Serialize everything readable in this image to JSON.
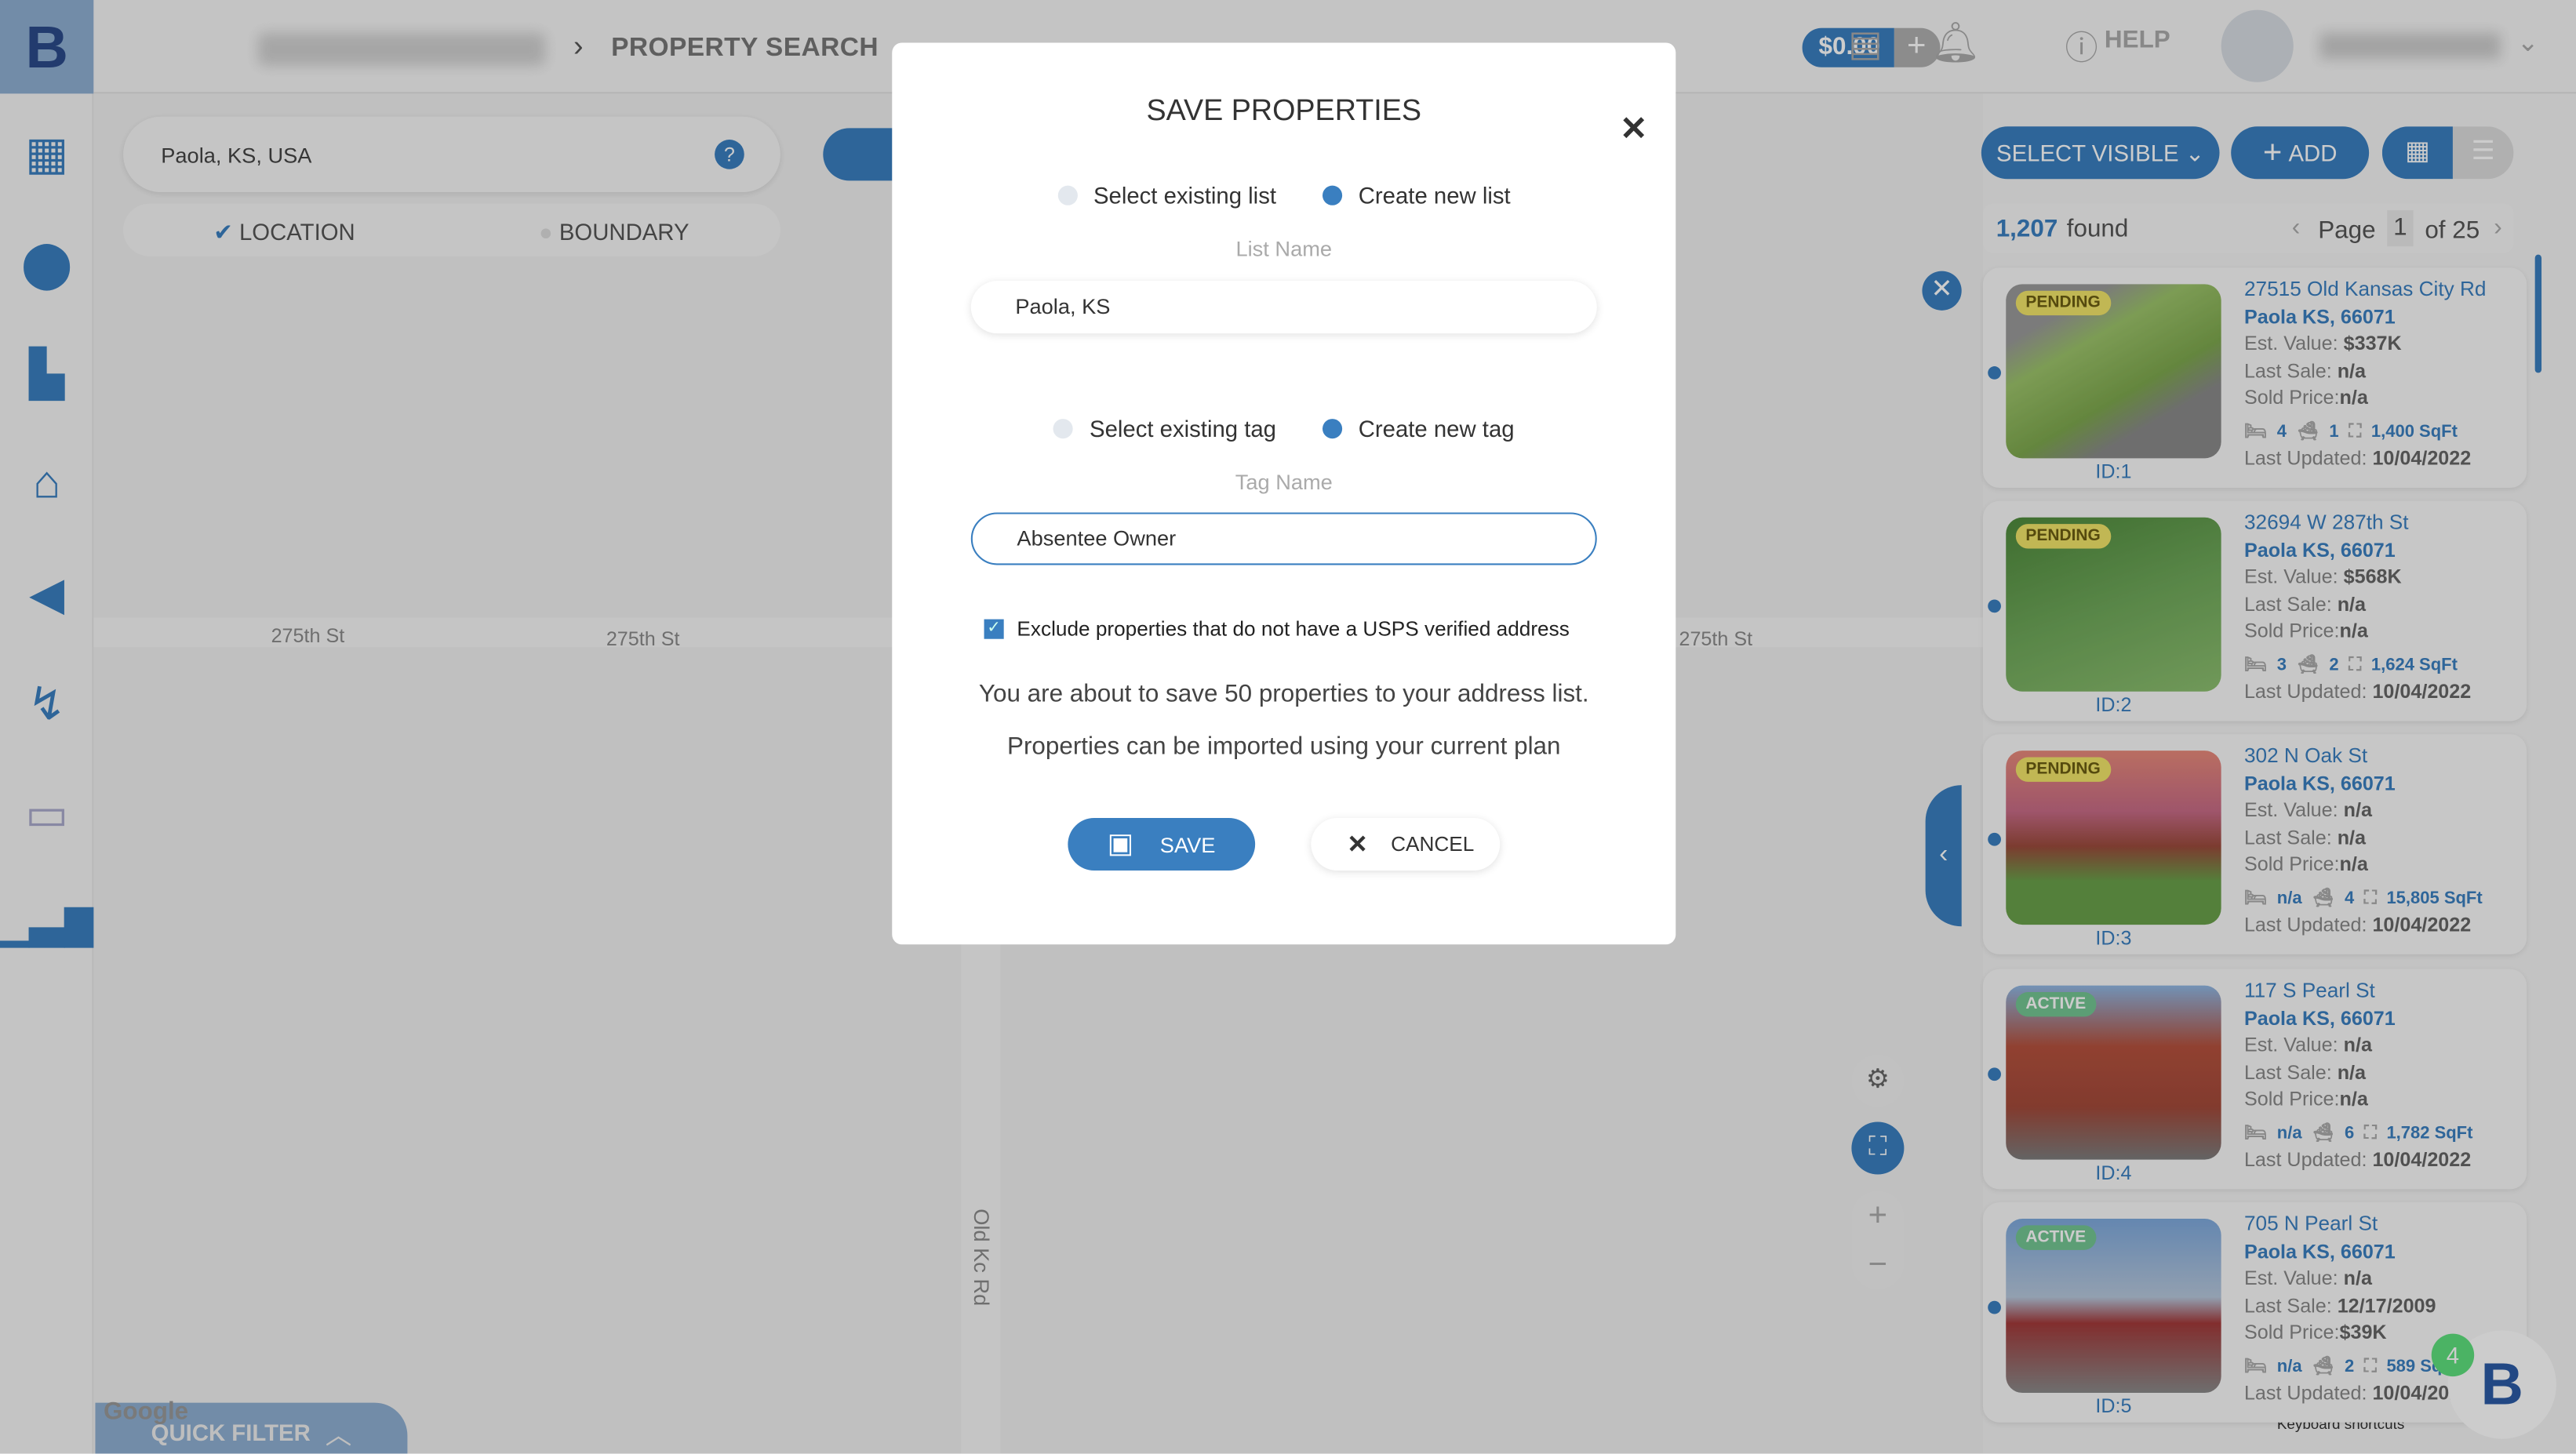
{
  "header": {
    "breadcrumb_current": "PROPERTY SEARCH",
    "credit": "$0.00",
    "help": "HELP"
  },
  "search": {
    "value": "Paola, KS, USA",
    "mode_location": "LOCATION",
    "mode_boundary": "BOUNDARY"
  },
  "map": {
    "streets": [
      "275th St",
      "275th St",
      "275th St"
    ],
    "road_vertical": "Old Kc Rd",
    "quick_filter": "QUICK FILTER",
    "google": "Google",
    "footer_shortcuts": "Keyboard shortcuts"
  },
  "results": {
    "select_visible": "SELECT VISIBLE",
    "add": "ADD",
    "count": "1,207",
    "found": "found",
    "page_label": "Page",
    "page": "1",
    "of": "of 25"
  },
  "properties": [
    {
      "status": "PENDING",
      "id": "ID:1",
      "address": "27515 Old Kansas City Rd",
      "city": "Paola KS, 66071",
      "est": "$337K",
      "last_sale": "n/a",
      "sold": "n/a",
      "beds": "4",
      "baths": "1",
      "sqft": "1,400 SqFt",
      "updated": "10/04/2022"
    },
    {
      "status": "PENDING",
      "id": "ID:2",
      "address": "32694 W 287th St",
      "city": "Paola KS, 66071",
      "est": "$568K",
      "last_sale": "n/a",
      "sold": "n/a",
      "beds": "3",
      "baths": "2",
      "sqft": "1,624 SqFt",
      "updated": "10/04/2022"
    },
    {
      "status": "PENDING",
      "id": "ID:3",
      "address": "302 N Oak St",
      "city": "Paola KS, 66071",
      "est": "n/a",
      "last_sale": "n/a",
      "sold": "n/a",
      "beds": "n/a",
      "baths": "4",
      "sqft": "15,805 SqFt",
      "updated": "10/04/2022"
    },
    {
      "status": "ACTIVE",
      "id": "ID:4",
      "address": "117 S Pearl St",
      "city": "Paola KS, 66071",
      "est": "n/a",
      "last_sale": "n/a",
      "sold": "n/a",
      "beds": "n/a",
      "baths": "6",
      "sqft": "1,782 SqFt",
      "updated": "10/04/2022"
    },
    {
      "status": "ACTIVE",
      "id": "ID:5",
      "address": "705 N Pearl St",
      "city": "Paola KS, 66071",
      "est": "n/a",
      "last_sale": "12/17/2009",
      "sold": "$39K",
      "beds": "n/a",
      "baths": "2",
      "sqft": "589 SqFt",
      "updated": "10/04/2022"
    }
  ],
  "labels": {
    "est": "Est. Value: ",
    "last_sale": "Last Sale: ",
    "sold": "Sold Price:",
    "updated": "Last Updated: "
  },
  "chat_badge": "4",
  "modal": {
    "title": "SAVE PROPERTIES",
    "list_existing": "Select existing list",
    "list_new": "Create new list",
    "list_label": "List Name",
    "list_value": "Paola, KS",
    "tag_existing": "Select existing tag",
    "tag_new": "Create new tag",
    "tag_label": "Tag Name",
    "tag_value": "Absentee Owner",
    "exclude": "Exclude properties that do not have a USPS verified address",
    "msg1": "You are about to save 50 properties to your address list.",
    "msg2": "Properties can be imported using your current plan",
    "save": "SAVE",
    "cancel": "CANCEL"
  },
  "colors": {
    "accent": "#3a7fc0",
    "pending": "#f2e56a",
    "active": "#74c693"
  }
}
